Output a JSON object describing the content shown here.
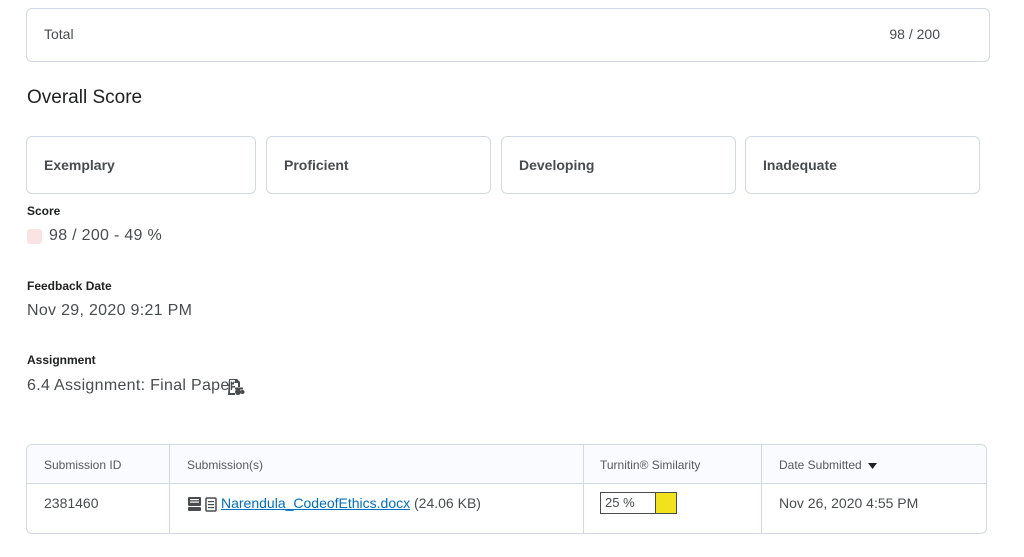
{
  "total": {
    "label": "Total",
    "value": "98 / 200"
  },
  "overall_score": {
    "title": "Overall Score",
    "levels": [
      "Exemplary",
      "Proficient",
      "Developing",
      "Inadequate"
    ]
  },
  "score": {
    "label": "Score",
    "value": "98 / 200 - 49 %",
    "swatch_color": "#fbe3e4"
  },
  "feedback_date": {
    "label": "Feedback Date",
    "value": "Nov 29, 2020 9:21 PM"
  },
  "assignment": {
    "label": "Assignment",
    "value": "6.4 Assignment: Final Paper",
    "icon": "assignment-info-icon"
  },
  "submissions": {
    "headers": {
      "submission_id": "Submission ID",
      "submissions": "Submission(s)",
      "similarity": "Turnitin® Similarity",
      "date_submitted": "Date Submitted"
    },
    "rows": [
      {
        "submission_id": "2381460",
        "file_name": "Narendula_CodeofEthics.docx",
        "file_size": "(24.06 KB)",
        "similarity": "25 %",
        "similarity_color": "#f2e21d",
        "date_submitted": "Nov 26, 2020 4:55 PM"
      }
    ]
  }
}
